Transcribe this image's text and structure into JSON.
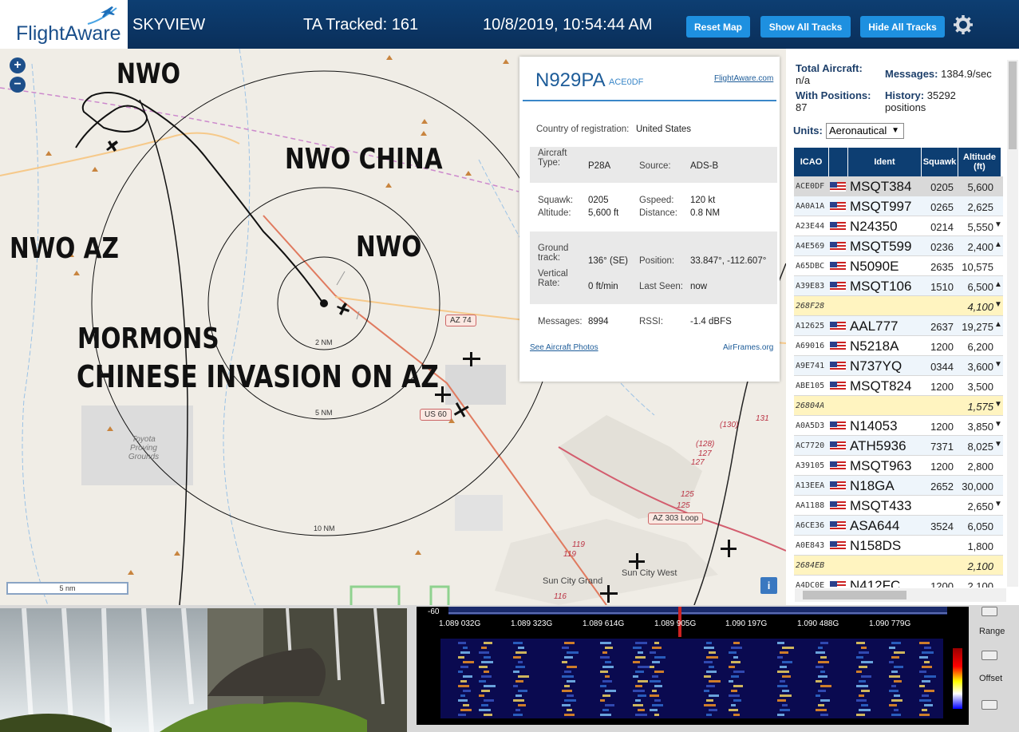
{
  "header": {
    "logo_text": "FlightAware",
    "app_title": "SKYVIEW",
    "tracked": "TA Tracked: 161",
    "datetime": "10/8/2019, 10:54:44 AM",
    "reset_map": "Reset Map",
    "show_all": "Show All Tracks",
    "hide_all": "Hide All Tracks",
    "settings_icon": "gear-icon"
  },
  "map": {
    "zoom_in": "+",
    "zoom_out": "−",
    "overlay": {
      "nwo_top": "NWO",
      "nwo_china": "NWO CHINA",
      "nwo_az": "NWO AZ",
      "nwo_center": "NWO",
      "mormons": "MORMONS",
      "invasion": "CHINESE INVASION ON AZ"
    },
    "rings": {
      "r2": "2 NM",
      "r5": "5 NM",
      "r10": "10 NM"
    },
    "roads": {
      "az74": "AZ 74",
      "us60": "US 60",
      "az303": "AZ 303 Loop"
    },
    "route_numbers": [
      "(130)",
      "131",
      "(128)",
      "127",
      "127",
      "125",
      "125",
      "119",
      "119",
      "116"
    ],
    "places": {
      "toyota": "Toyota Proving Grounds",
      "suncity_grand": "Sun City Grand",
      "suncity_west": "Sun City West"
    },
    "scale": "5 nm",
    "info": "i"
  },
  "popup": {
    "ident": "N929PA",
    "icao": "ACE0DF",
    "fa_link": "FlightAware.com",
    "country_label": "Country of registration:",
    "country": "United States",
    "aircraft_type_label": "Aircraft Type:",
    "aircraft_type": "P28A",
    "source_label": "Source:",
    "source": "ADS-B",
    "squawk_label": "Squawk:",
    "squawk": "0205",
    "gspeed_label": "Gspeed:",
    "gspeed": "120 kt",
    "altitude_label": "Altitude:",
    "altitude": "5,600 ft",
    "distance_label": "Distance:",
    "distance": "0.8 NM",
    "ground_track_label": "Ground track:",
    "ground_track": "136° (SE)",
    "position_label": "Position:",
    "position": "33.847°, -112.607°",
    "vertical_rate_label": "Vertical Rate:",
    "vertical_rate": "0 ft/min",
    "last_seen_label": "Last Seen:",
    "last_seen": "now",
    "messages_label": "Messages:",
    "messages": "8994",
    "rssi_label": "RSSI:",
    "rssi": "-1.4 dBFS",
    "photos_link": "See Aircraft Photos",
    "airframes_link": "AirFrames.org"
  },
  "stats": {
    "total_label": "Total Aircraft:",
    "total": "n/a",
    "messages_label": "Messages:",
    "messages": "1384.9/sec",
    "with_pos_label": "With Positions:",
    "with_pos": "87",
    "history_label": "History:",
    "history": "35292 positions",
    "units_label": "Units:",
    "units": "Aeronautical"
  },
  "table": {
    "headers": [
      "ICAO",
      "",
      "Ident",
      "Squawk",
      "Altitude (ft)"
    ],
    "rows": [
      {
        "icao": "ACE0DF",
        "flag": true,
        "ident": "MSQT384",
        "squawk": "0205",
        "alt": "5,600",
        "arrow": "",
        "style": "sel"
      },
      {
        "icao": "AA0A1A",
        "flag": true,
        "ident": "MSQT997",
        "squawk": "0265",
        "alt": "2,625",
        "arrow": "",
        "style": "blue"
      },
      {
        "icao": "A23E44",
        "flag": true,
        "ident": "N24350",
        "squawk": "0214",
        "alt": "5,550",
        "arrow": "▼",
        "style": ""
      },
      {
        "icao": "A4E569",
        "flag": true,
        "ident": "MSQT599",
        "squawk": "0236",
        "alt": "2,400",
        "arrow": "▲",
        "style": "blue"
      },
      {
        "icao": "A65DBC",
        "flag": true,
        "ident": "N5090E",
        "squawk": "2635",
        "alt": "10,575",
        "arrow": "",
        "style": ""
      },
      {
        "icao": "A39E83",
        "flag": true,
        "ident": "MSQT106",
        "squawk": "1510",
        "alt": "6,500",
        "arrow": "▲",
        "style": "blue"
      },
      {
        "icao": "268F28",
        "flag": false,
        "ident": "",
        "squawk": "",
        "alt": "4,100",
        "arrow": "▼",
        "style": "yel"
      },
      {
        "icao": "A12625",
        "flag": true,
        "ident": "AAL777",
        "squawk": "2637",
        "alt": "19,275",
        "arrow": "▲",
        "style": "blue"
      },
      {
        "icao": "A69016",
        "flag": true,
        "ident": "N5218A",
        "squawk": "1200",
        "alt": "6,200",
        "arrow": "",
        "style": ""
      },
      {
        "icao": "A9E741",
        "flag": true,
        "ident": "N737YQ",
        "squawk": "0344",
        "alt": "3,600",
        "arrow": "▼",
        "style": "blue"
      },
      {
        "icao": "ABE105",
        "flag": true,
        "ident": "MSQT824",
        "squawk": "1200",
        "alt": "3,500",
        "arrow": "",
        "style": ""
      },
      {
        "icao": "26804A",
        "flag": false,
        "ident": "",
        "squawk": "",
        "alt": "1,575",
        "arrow": "▼",
        "style": "yel"
      },
      {
        "icao": "A0A5D3",
        "flag": true,
        "ident": "N14053",
        "squawk": "1200",
        "alt": "3,850",
        "arrow": "▼",
        "style": ""
      },
      {
        "icao": "AC7720",
        "flag": true,
        "ident": "ATH5936",
        "squawk": "7371",
        "alt": "8,025",
        "arrow": "▼",
        "style": "blue"
      },
      {
        "icao": "A39105",
        "flag": true,
        "ident": "MSQT963",
        "squawk": "1200",
        "alt": "2,800",
        "arrow": "",
        "style": ""
      },
      {
        "icao": "A13EEA",
        "flag": true,
        "ident": "N18GA",
        "squawk": "2652",
        "alt": "30,000",
        "arrow": "",
        "style": "blue"
      },
      {
        "icao": "AA1188",
        "flag": true,
        "ident": "MSQT433",
        "squawk": "",
        "alt": "2,650",
        "arrow": "▼",
        "style": ""
      },
      {
        "icao": "A6CE36",
        "flag": true,
        "ident": "ASA644",
        "squawk": "3524",
        "alt": "6,050",
        "arrow": "",
        "style": "blue"
      },
      {
        "icao": "A0E843",
        "flag": true,
        "ident": "N158DS",
        "squawk": "",
        "alt": "1,800",
        "arrow": "",
        "style": ""
      },
      {
        "icao": "2684EB",
        "flag": false,
        "ident": "",
        "squawk": "",
        "alt": "2,100",
        "arrow": "",
        "style": "yel"
      },
      {
        "icao": "A4DC0E",
        "flag": true,
        "ident": "N412FC",
        "squawk": "1200",
        "alt": "2,100",
        "arrow": "",
        "style": ""
      }
    ]
  },
  "spectrum": {
    "db": "-60",
    "freqs": [
      "1.089 032G",
      "1.089 323G",
      "1.089 614G",
      "1.089 905G",
      "1.090 197G",
      "1.090 488G",
      "1.090 779G"
    ],
    "range_label": "Range",
    "offset_label": "Offset"
  },
  "colors": {
    "header": "#0d3e72",
    "button": "#1e90e0",
    "accent": "#1d5c99"
  }
}
